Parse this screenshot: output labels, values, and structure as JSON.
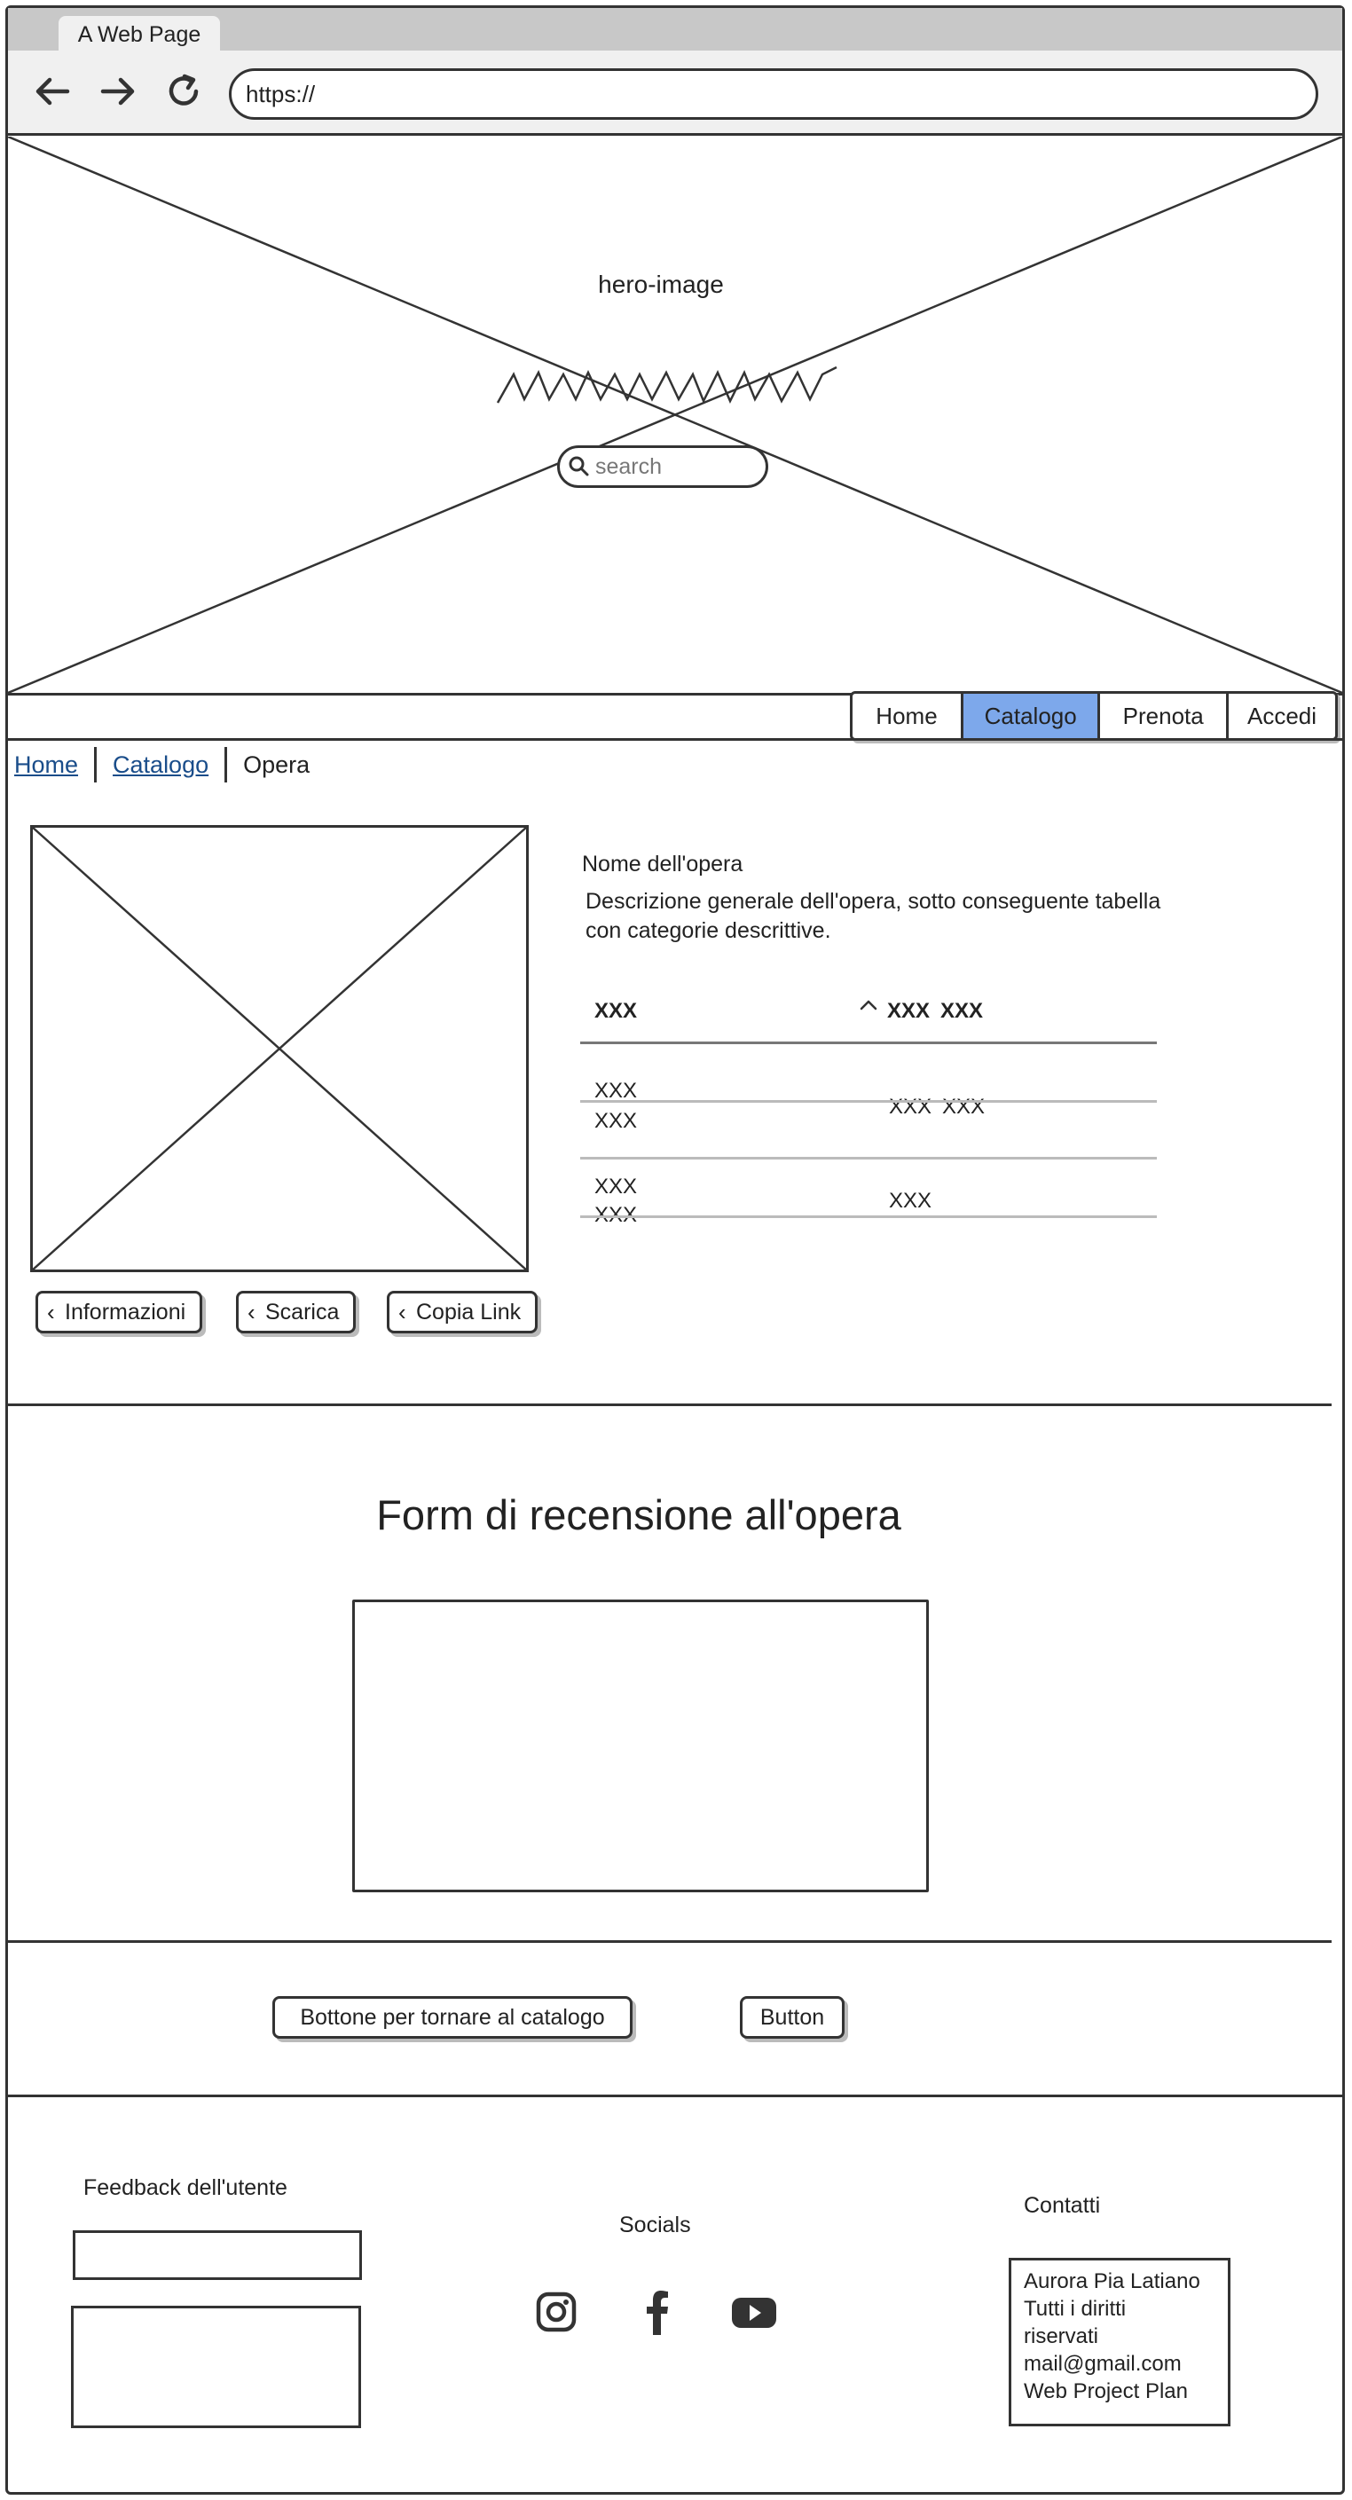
{
  "browser": {
    "tab_title": "A Web Page",
    "url": "https://"
  },
  "hero": {
    "label": "hero-image",
    "search_placeholder": "search"
  },
  "nav": {
    "items": [
      "Home",
      "Catalogo",
      "Prenota",
      "Accedi"
    ],
    "active": "Catalogo",
    "active_color": "#7da8eb"
  },
  "breadcrumb": {
    "home": "Home",
    "catalog": "Catalogo",
    "current": "Opera"
  },
  "artwork": {
    "name": "Nome dell'opera",
    "description": "Descrizione generale dell'opera, sotto conseguente tabella con categorie descrittive.",
    "table": {
      "headers": [
        "XXX",
        "XXX",
        "XXX"
      ],
      "rows": [
        {
          "c1": "XXX",
          "c1b": "XXX",
          "c2": "XXX",
          "c3": "XXX"
        },
        {
          "c1": "XXX",
          "c1b": "XXX",
          "c2": "XXX"
        }
      ]
    },
    "actions": [
      "Informazioni",
      "Scarica",
      "Copia Link"
    ]
  },
  "review_form": {
    "title": "Form di recensione all'opera"
  },
  "buttons": {
    "back_to_catalog": "Bottone per tornare al catalogo",
    "generic": "Button"
  },
  "footer": {
    "feedback_title": "Feedback dell'utente",
    "socials_title": "Socials",
    "socials": [
      "instagram-icon",
      "facebook-icon",
      "youtube-icon"
    ],
    "contacts_title": "Contatti",
    "contacts_lines": [
      "Aurora Pia Latiano",
      "Tutti i diritti",
      "riservati",
      "mail@gmail.com",
      "Web Project Plan"
    ]
  }
}
